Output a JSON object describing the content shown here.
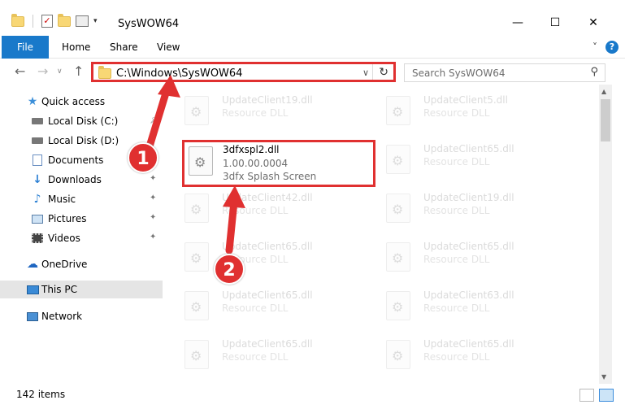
{
  "window": {
    "title": "SysWOW64",
    "minimize_glyph": "—",
    "maximize_glyph": "☐",
    "close_glyph": "✕"
  },
  "ribbon": {
    "tabs": [
      "File",
      "Home",
      "Share",
      "View"
    ],
    "help_glyph": "?",
    "expand_glyph": "˅"
  },
  "address_bar": {
    "path": "C:\\Windows\\SysWOW64",
    "refresh_glyph": "↻",
    "dropdown_glyph": "∨"
  },
  "search": {
    "placeholder": "Search SysWOW64"
  },
  "sidebar": {
    "items": [
      {
        "label": "Quick access",
        "icon": "star-icon"
      },
      {
        "label": "Local Disk (C:)",
        "icon": "drive-icon"
      },
      {
        "label": "Local Disk (D:)",
        "icon": "drive-icon"
      },
      {
        "label": "Documents",
        "icon": "documents-icon"
      },
      {
        "label": "Downloads",
        "icon": "download-icon"
      },
      {
        "label": "Music",
        "icon": "music-icon"
      },
      {
        "label": "Pictures",
        "icon": "pictures-icon"
      },
      {
        "label": "Videos",
        "icon": "videos-icon"
      },
      {
        "label": "OneDrive",
        "icon": "cloud-icon"
      },
      {
        "label": "This PC",
        "icon": "computer-icon"
      },
      {
        "label": "Network",
        "icon": "network-icon"
      }
    ]
  },
  "files": {
    "left": [
      {
        "name": "UpdateClient19.dll",
        "desc": "Resource DLL"
      },
      {
        "name": "UpdateClient42.dll",
        "desc": "Resource DLL"
      },
      {
        "name": "UpdateClient65.dll",
        "desc": "Resource DLL"
      },
      {
        "name": "UpdateClient65.dll",
        "desc": "Resource DLL"
      },
      {
        "name": "UpdateClient65.dll",
        "desc": "Resource DLL"
      }
    ],
    "right": [
      {
        "name": "UpdateClient5.dll",
        "desc": "Resource DLL"
      },
      {
        "name": "UpdateClient65.dll",
        "desc": "Resource DLL"
      },
      {
        "name": "UpdateClient19.dll",
        "desc": "Resource DLL"
      },
      {
        "name": "UpdateClient65.dll",
        "desc": "Resource DLL"
      },
      {
        "name": "UpdateClient63.dll",
        "desc": "Resource DLL"
      },
      {
        "name": "UpdateClient65.dll",
        "desc": "Resource DLL"
      }
    ],
    "highlighted": {
      "name": "3dfxspl2.dll",
      "version": "1.00.00.0004",
      "desc": "3dfx Splash Screen"
    }
  },
  "status": {
    "item_count": "142 items"
  },
  "annotations": {
    "step1": "1",
    "step2": "2",
    "color": "#e03030"
  }
}
